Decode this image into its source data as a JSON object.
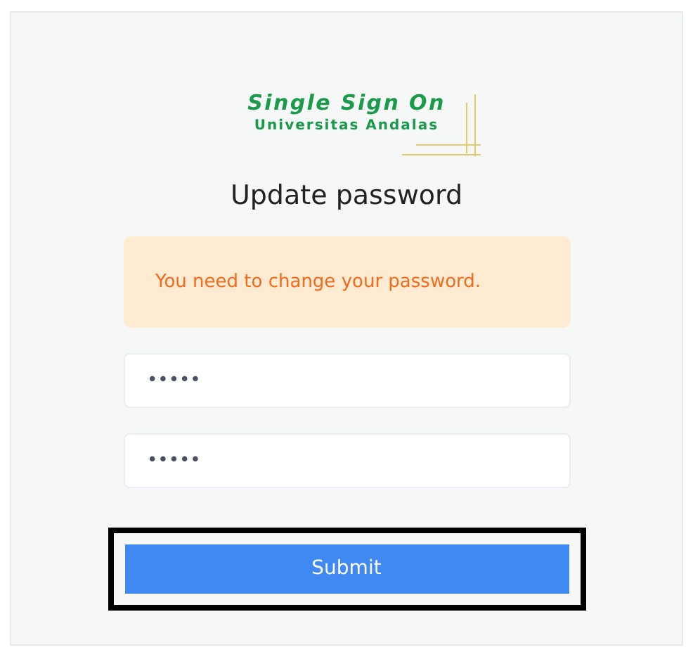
{
  "logo": {
    "title": "Single Sign On",
    "subtitle": "Universitas Andalas"
  },
  "heading": "Update password",
  "alert": {
    "message": "You need to change your password."
  },
  "fields": [
    {
      "value": "•••••"
    },
    {
      "value": "•••••"
    }
  ],
  "submit": {
    "label": "Submit",
    "focused": true
  }
}
